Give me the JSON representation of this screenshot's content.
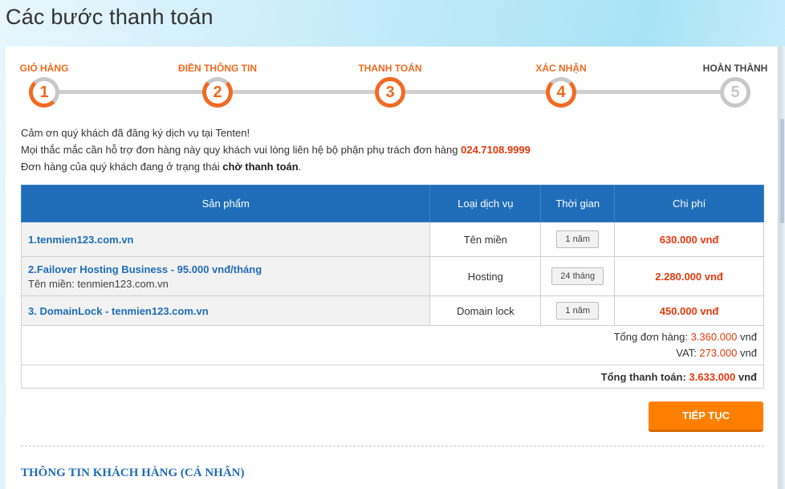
{
  "page": {
    "title": "Các bước thanh toán"
  },
  "steps": [
    {
      "label": "GIỎ HÀNG",
      "number": "1"
    },
    {
      "label": "ĐIỀN THÔNG TIN",
      "number": "2"
    },
    {
      "label": "THANH TOÁN",
      "number": "3"
    },
    {
      "label": "XÁC NHẬN",
      "number": "4"
    },
    {
      "label": "HOÀN THÀNH",
      "number": "5"
    }
  ],
  "message": {
    "line1": "Cảm ơn quý khách đã đăng ký dịch vụ tại Tenten!",
    "line2_prefix": "Mọi thắc mắc cần hỗ trợ đơn hàng này quy khách vui lòng liên hệ bộ phận phụ trách đơn hàng ",
    "hotline": "024.7108.9999",
    "line3_prefix": "Đơn hàng của quý khách đang ở trạng thái ",
    "status": "chờ thanh toán",
    "line3_suffix": "."
  },
  "table": {
    "headers": {
      "product": "Sản phẩm",
      "type": "Loại dịch vụ",
      "time": "Thời gian",
      "cost": "Chi phí"
    },
    "rows": [
      {
        "name": "1.tenmien123.com.vn",
        "sub": "",
        "type": "Tên miền",
        "time": "1 năm",
        "cost": "630.000 vnđ"
      },
      {
        "name": "2.Failover Hosting Business - 95.000 vnđ/tháng",
        "sub": "Tên miền: tenmien123.com.vn",
        "type": "Hosting",
        "time": "24 tháng",
        "cost": "2.280.000 vnđ"
      },
      {
        "name": "3. DomainLock - tenmien123.com.vn",
        "sub": "",
        "type": "Domain lock",
        "time": "1 năm",
        "cost": "450.000 vnđ"
      }
    ],
    "summary": {
      "order_total_label": "Tổng đơn hàng: ",
      "order_total_value": "3.360.000",
      "vat_label": "VAT: ",
      "vat_value": "273.000",
      "currency": " vnđ",
      "payment_total_label": "Tổng thanh toán: ",
      "payment_total_value": "3.633.000"
    }
  },
  "button": {
    "continue_label": "TIẾP TỤC"
  },
  "section": {
    "customer_info_title": "THÔNG TIN KHÁCH HÀNG (CÁ NHÂN)"
  },
  "colors": {
    "accent": "#f26a21",
    "header_blue": "#1f6db8",
    "price_red": "#e8390d",
    "button_orange": "#ff7f00"
  }
}
